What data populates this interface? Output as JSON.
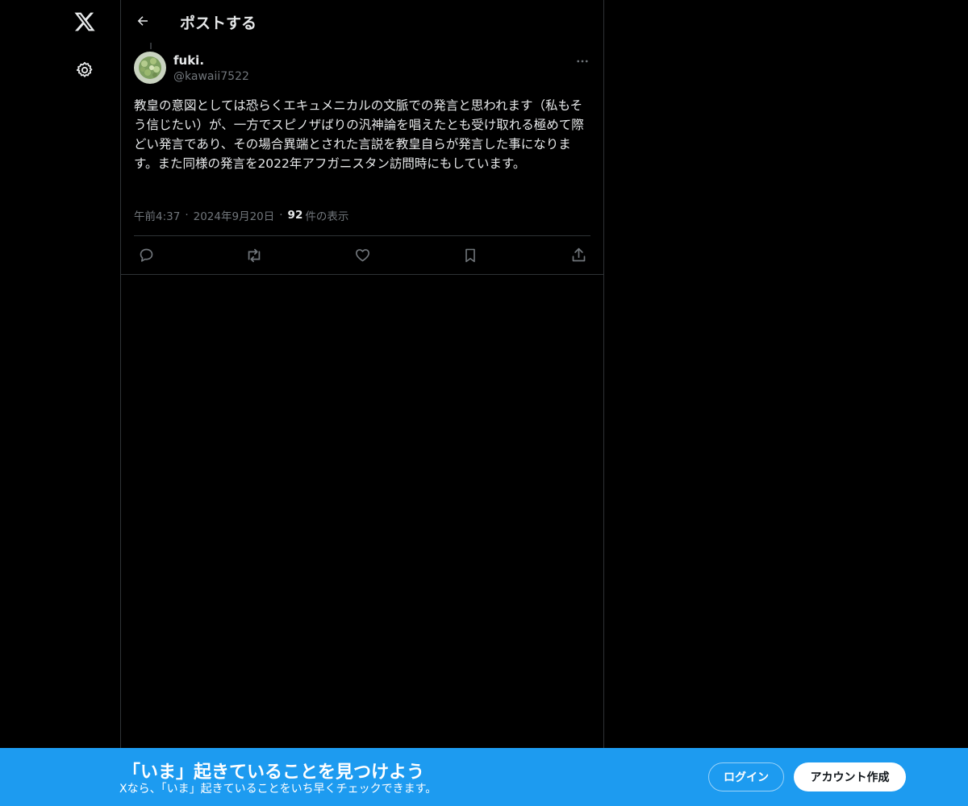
{
  "header": {
    "title": "ポストする"
  },
  "post": {
    "author": {
      "display_name": "fuki.",
      "handle": "@kawaii7522"
    },
    "text": "教皇の意図としては恐らくエキュメニカルの文脈での発言と思われます（私もそう信じたい）が、一方でスピノザばりの汎神論を唱えたとも受け取れる極めて際どい発言であり、その場合異端とされた言説を教皇自らが発言した事になります。また同様の発言を2022年アフガニスタン訪問時にもしています。",
    "time": "午前4:37",
    "date": "2024年9月20日",
    "views_count": "92",
    "views_label": "件の表示",
    "separator": "·"
  },
  "icons": {
    "logo": "x-logo-icon",
    "settings": "gear-icon",
    "back": "arrow-left-icon",
    "more": "more-horizontal-icon",
    "reply": "reply-icon",
    "repost": "repost-icon",
    "like": "heart-icon",
    "bookmark": "bookmark-icon",
    "share": "share-icon"
  },
  "banner": {
    "title": "「いま」起きていることを見つけよう",
    "subtitle": "Xなら、「いま」起きていることをいち早くチェックできます。",
    "login_label": "ログイン",
    "signup_label": "アカウント作成"
  },
  "colors": {
    "background": "#000000",
    "text_primary": "#e7e9ea",
    "text_secondary": "#71767b",
    "border": "#2f3336",
    "banner": "#1d9bf0"
  }
}
